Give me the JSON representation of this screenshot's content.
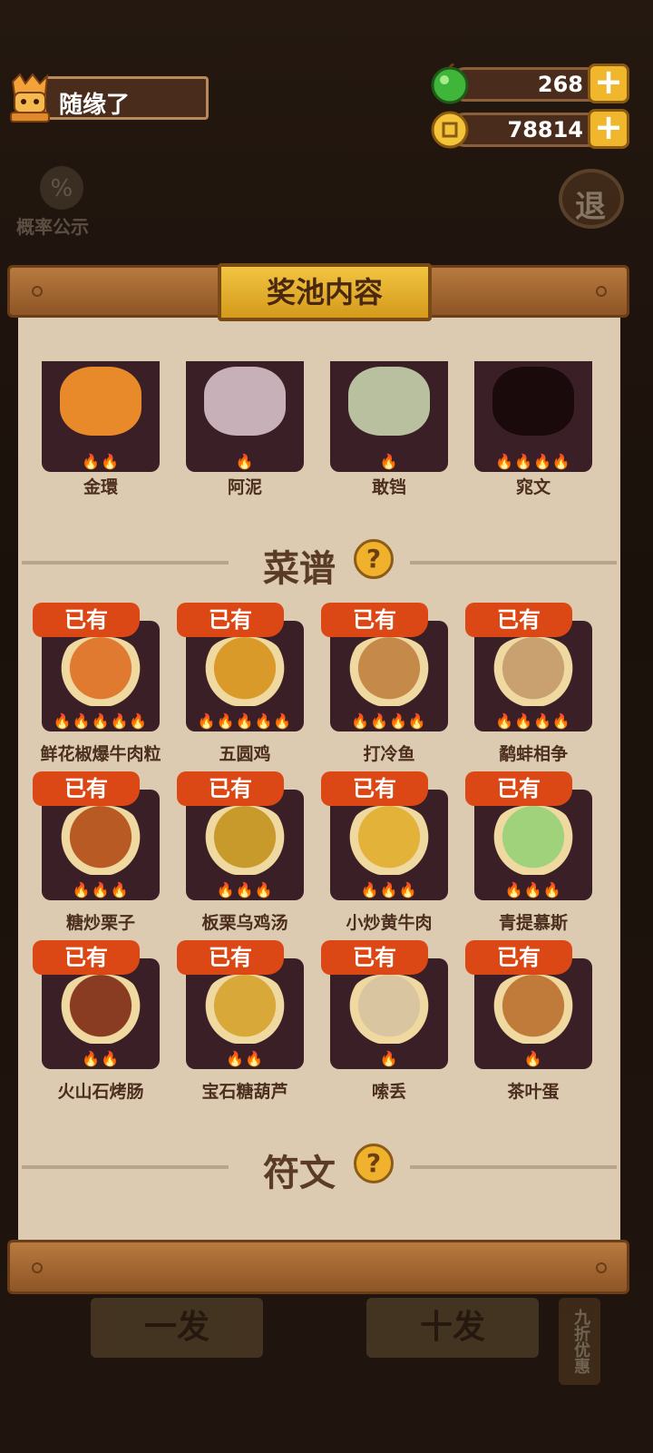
{
  "user": {
    "name": "随缘了"
  },
  "resources": {
    "gems": "268",
    "coins": "78814"
  },
  "probability_label": "概率公示",
  "exit_label": "退",
  "panel": {
    "title": "奖池内容"
  },
  "top_row": [
    {
      "name": "金環",
      "stars": "🔥🔥"
    },
    {
      "name": "阿泥",
      "stars": "🔥"
    },
    {
      "name": "敢铛",
      "stars": "🔥"
    },
    {
      "name": "窕文",
      "stars": "🔥🔥🔥🔥"
    }
  ],
  "sections": {
    "recipes": "菜谱",
    "runes": "符文",
    "help_icon": "?"
  },
  "owned_label": "已有",
  "recipes": [
    {
      "name": "鲜花椒爆牛肉粒",
      "stars": "🔥🔥🔥🔥🔥",
      "color": "#e07a30"
    },
    {
      "name": "五圆鸡",
      "stars": "🔥🔥🔥🔥🔥",
      "color": "#d99a2a"
    },
    {
      "name": "打冷鱼",
      "stars": "🔥🔥🔥🔥",
      "color": "#c58a4a"
    },
    {
      "name": "鹬蚌相争",
      "stars": "🔥🔥🔥🔥",
      "color": "#c9a070"
    },
    {
      "name": "糖炒栗子",
      "stars": "🔥🔥🔥",
      "color": "#b85a24"
    },
    {
      "name": "板栗乌鸡汤",
      "stars": "🔥🔥🔥",
      "color": "#c89a2c"
    },
    {
      "name": "小炒黄牛肉",
      "stars": "🔥🔥🔥",
      "color": "#e3b238"
    },
    {
      "name": "青提慕斯",
      "stars": "🔥🔥🔥",
      "color": "#9fd27a"
    },
    {
      "name": "火山石烤肠",
      "stars": "🔥🔥",
      "color": "#8a3c22"
    },
    {
      "name": "宝石糖葫芦",
      "stars": "🔥🔥",
      "color": "#d8a838"
    },
    {
      "name": "嗦丢",
      "stars": "🔥",
      "color": "#d9c5a0"
    },
    {
      "name": "茶叶蛋",
      "stars": "🔥",
      "color": "#c07a3a"
    }
  ],
  "bottom": {
    "single": "一发",
    "ten": "十发",
    "discount": "九折优惠"
  }
}
